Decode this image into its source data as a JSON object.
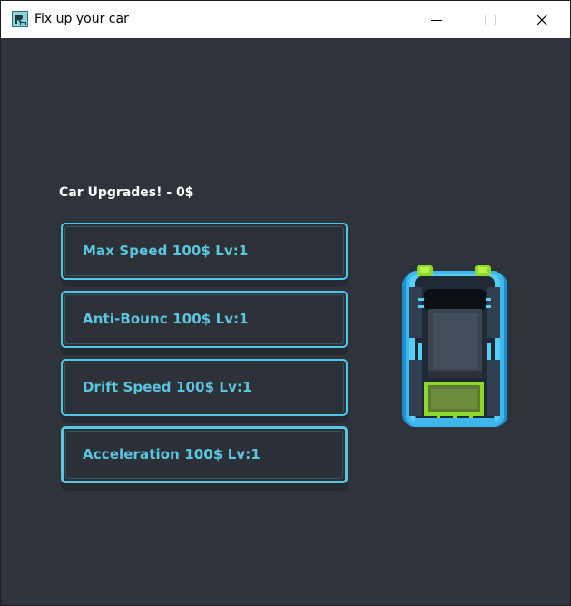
{
  "window": {
    "title": "Fix up your car",
    "controls": [
      "minimize-icon",
      "maximize-icon",
      "close-icon"
    ]
  },
  "upgrades": {
    "heading": "Car Upgrades! - 0$",
    "items": [
      {
        "label": "Max Speed 100$ Lv:1",
        "active": false
      },
      {
        "label": "Anti-Bounc 100$ Lv:1",
        "active": false
      },
      {
        "label": "Drift Speed 100$ Lv:1",
        "active": false
      },
      {
        "label": "Acceleration 100$ Lv:1",
        "active": true
      }
    ]
  },
  "colors": {
    "background": "#2f343c",
    "accent": "#4ec8e8",
    "car_green": "#8ed82c"
  },
  "icons": {
    "app": "app-logo-icon",
    "car": "car-sprite-icon"
  }
}
